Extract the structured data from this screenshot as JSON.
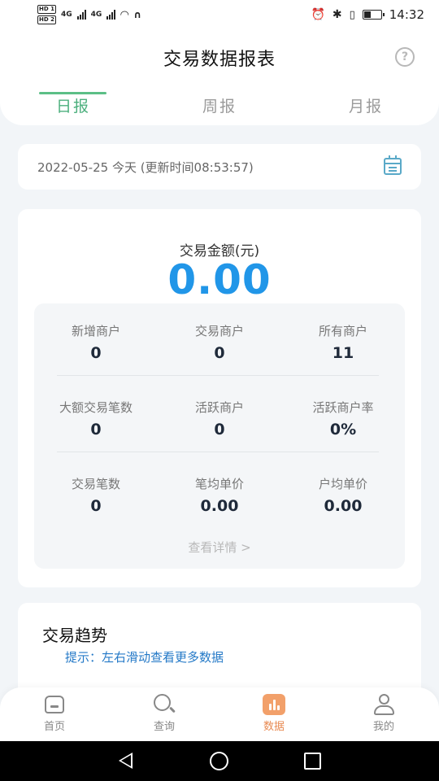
{
  "status_bar": {
    "hd1": "HD 1",
    "hd2": "HD 2",
    "net1": "4G",
    "net2": "4G",
    "time": "14:32"
  },
  "header": {
    "title": "交易数据报表",
    "help_icon": "question-circle-icon"
  },
  "tabs": [
    {
      "label": "日报",
      "active": true
    },
    {
      "label": "周报",
      "active": false
    },
    {
      "label": "月报",
      "active": false
    }
  ],
  "date_bar": {
    "text": "2022-05-25 今天 (更新时间08:53:57)",
    "icon": "calendar-icon"
  },
  "summary": {
    "amount_label": "交易金额(元)",
    "amount_value": "0.00",
    "stats": [
      [
        {
          "label": "新增商户",
          "value": "0"
        },
        {
          "label": "交易商户",
          "value": "0"
        },
        {
          "label": "所有商户",
          "value": "11"
        }
      ],
      [
        {
          "label": "大额交易笔数",
          "value": "0"
        },
        {
          "label": "活跃商户",
          "value": "0"
        },
        {
          "label": "活跃商户率",
          "value": "0%"
        }
      ],
      [
        {
          "label": "交易笔数",
          "value": "0"
        },
        {
          "label": "笔均单价",
          "value": "0.00"
        },
        {
          "label": "户均单价",
          "value": "0.00"
        }
      ]
    ],
    "details_link": "查看详情 >"
  },
  "trend": {
    "title": "交易趋势",
    "hint": "提示：左右滑动查看更多数据"
  },
  "bottom_nav": [
    {
      "label": "首页",
      "icon": "home-icon",
      "active": false
    },
    {
      "label": "查询",
      "icon": "search-icon",
      "active": false
    },
    {
      "label": "数据",
      "icon": "data-chart-icon",
      "active": true
    },
    {
      "label": "我的",
      "icon": "user-icon",
      "active": false
    }
  ],
  "colors": {
    "accent_green": "#4caf7d",
    "amount_blue": "#2196e8",
    "nav_active_orange": "#e88a52",
    "hint_blue": "#2479c7"
  }
}
